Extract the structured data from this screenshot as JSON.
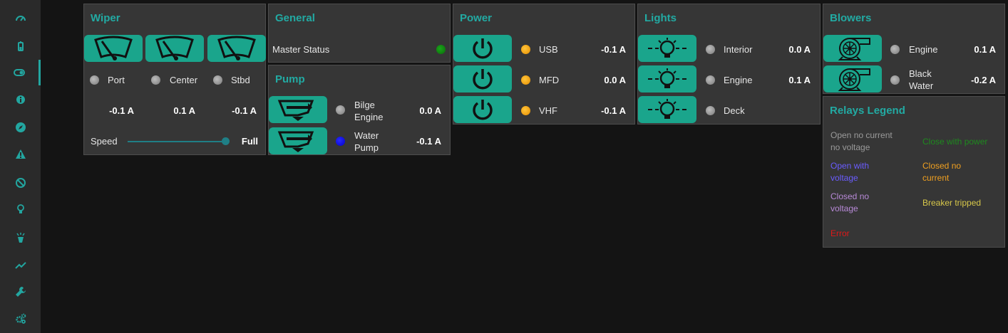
{
  "sidebar": {
    "items": [
      {
        "icon": "gauge-icon"
      },
      {
        "icon": "battery-icon"
      },
      {
        "icon": "toggle-icon"
      },
      {
        "icon": "info-icon"
      },
      {
        "icon": "compass-icon"
      },
      {
        "icon": "warning-icon"
      },
      {
        "icon": "ban-icon"
      },
      {
        "icon": "bulb-icon"
      },
      {
        "icon": "spotlight-icon"
      },
      {
        "icon": "chart-line-icon"
      },
      {
        "icon": "wrench-icon"
      },
      {
        "icon": "cogs-icon"
      }
    ],
    "accent": "#22a6a0"
  },
  "wiper": {
    "title": "Wiper",
    "channels": [
      {
        "label": "Port",
        "current": "-0.1 A",
        "state": "off"
      },
      {
        "label": "Center",
        "current": "0.1 A",
        "state": "off"
      },
      {
        "label": "Stbd",
        "current": "-0.1 A",
        "state": "off"
      }
    ],
    "speed_label": "Speed",
    "speed_value": "Full",
    "speed_level": 1.0
  },
  "general": {
    "title": "General",
    "master_label": "Master Status",
    "master_state": "green"
  },
  "pump": {
    "title": "Pump",
    "items": [
      {
        "label_line1": "Bilge",
        "label_line2": "Engine",
        "current": "0.0 A",
        "state": "off"
      },
      {
        "label_line1": "Water",
        "label_line2": "Pump",
        "current": "-0.1 A",
        "state": "blue"
      }
    ]
  },
  "power": {
    "title": "Power",
    "items": [
      {
        "label": "USB",
        "current": "-0.1 A",
        "state": "on"
      },
      {
        "label": "MFD",
        "current": "0.0 A",
        "state": "on"
      },
      {
        "label": "VHF",
        "current": "-0.1 A",
        "state": "on"
      }
    ]
  },
  "lights": {
    "title": "Lights",
    "items": [
      {
        "label": "Interior",
        "current": "0.0 A",
        "state": "off"
      },
      {
        "label": "Engine",
        "current": "0.1 A",
        "state": "off"
      },
      {
        "label": "Deck",
        "current": "",
        "state": "off"
      }
    ]
  },
  "blowers": {
    "title": "Blowers",
    "items": [
      {
        "label_line1": "Engine",
        "label_line2": "",
        "current": "0.1 A",
        "state": "off"
      },
      {
        "label_line1": "Black",
        "label_line2": "Water",
        "current": "-0.2 A",
        "state": "off"
      }
    ]
  },
  "legend": {
    "title": "Relays Legend",
    "open_no_current_1": "Open no current",
    "open_no_current_2": "no voltage",
    "close_with_power": "Close with power",
    "open_with_voltage_1": "Open with",
    "open_with_voltage_2": "voltage",
    "closed_no_current_1": "Closed no",
    "closed_no_current_2": "current",
    "closed_no_voltage_1": "Closed no",
    "closed_no_voltage_2": "voltage",
    "breaker_tripped": "Breaker tripped",
    "error": "Error",
    "colors": {
      "open_no_current": "#9a9a9a",
      "close_with_power": "#1e8a1e",
      "open_with_voltage": "#6a5cff",
      "closed_no_current": "#f0a020",
      "closed_no_voltage": "#b88ad8",
      "breaker_tripped": "#d8c84a",
      "error": "#e01818"
    }
  }
}
